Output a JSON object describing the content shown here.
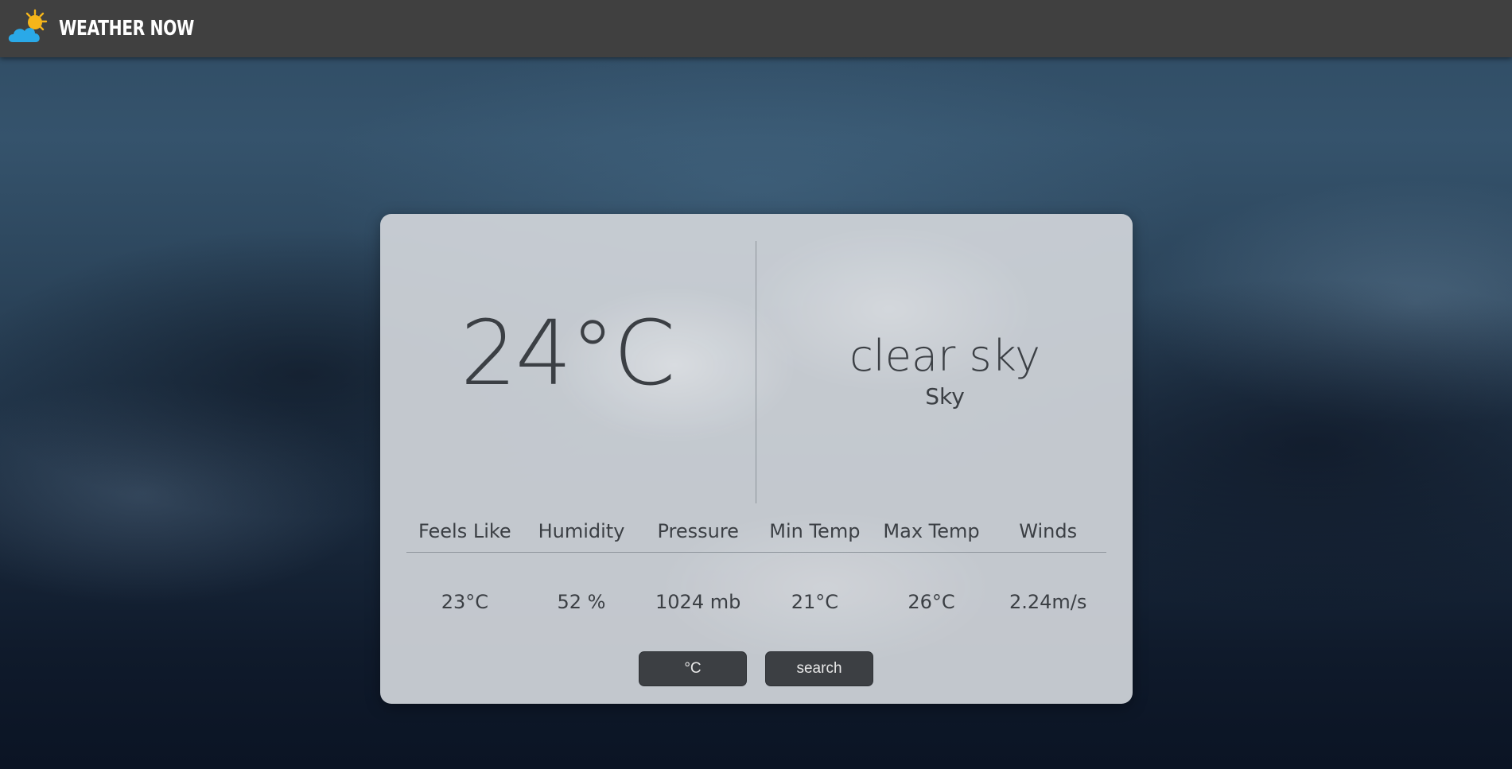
{
  "navbar": {
    "title": "WEATHER NOW",
    "logo_icon": "sun-behind-cloud-icon",
    "sun_color": "#f5b51a",
    "cloud_color": "#2aa9e8"
  },
  "weather": {
    "temperature": "24°C",
    "description": "clear sky",
    "main": "Sky"
  },
  "stats": {
    "headers": [
      "Feels Like",
      "Humidity",
      "Pressure",
      "Min Temp",
      "Max Temp",
      "Winds"
    ],
    "values": [
      "23°C",
      "52 %",
      "1024 mb",
      "21°C",
      "26°C",
      "2.24m/s"
    ]
  },
  "buttons": {
    "unit_label": "°C",
    "search_label": "search"
  }
}
